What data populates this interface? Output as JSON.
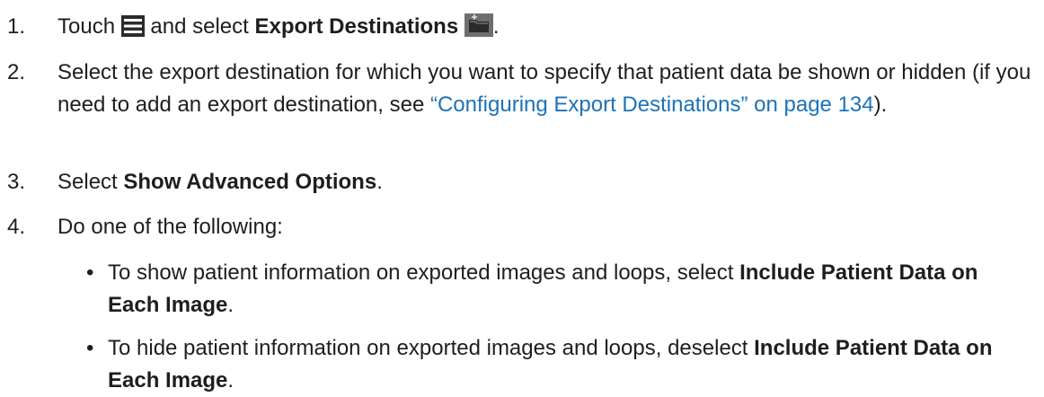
{
  "steps": [
    {
      "number": "1.",
      "t1": "Touch",
      "t2": "and select",
      "bold1": "Export Destinations",
      "t3": "."
    },
    {
      "number": "2.",
      "t1": "Select the export destination for which you want to specify that patient data be shown or hidden (if you need to add an export destination, see",
      "link": "“Configuring Export Destinations” on page 134",
      "t2": ")."
    },
    {
      "number": "3.",
      "t1": "Select",
      "bold1": "Show Advanced Options",
      "t2": "."
    },
    {
      "number": "4.",
      "t1": "Do one of the following:"
    }
  ],
  "bullets": [
    {
      "symbol": "•",
      "t1": "To show patient information on exported images and loops, select",
      "bold1": "Include Patient Data on Each Image",
      "t2": "."
    },
    {
      "symbol": "•",
      "t1": "To hide patient information on exported images and loops, deselect",
      "bold1": "Include Patient Data on Each Image",
      "t2": "."
    }
  ],
  "icons": {
    "menu": "menu-icon",
    "export_destinations": "export-destinations-icon"
  },
  "colors": {
    "link": "#1b73b8",
    "text": "#1e1e1e"
  }
}
